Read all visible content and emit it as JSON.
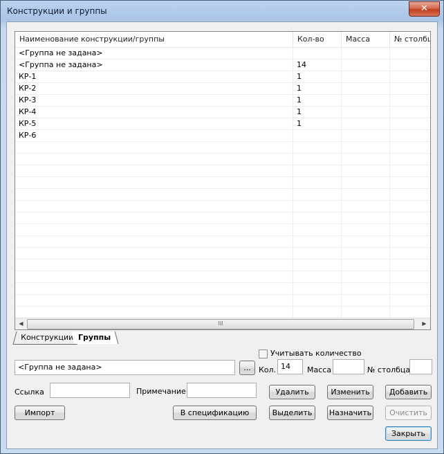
{
  "window": {
    "title": "Конструкции и группы",
    "close_label": "✕"
  },
  "grid": {
    "columns": [
      "Наименование конструкции/группы",
      "Кол-во",
      "Масса",
      "№ столбца"
    ],
    "rows": [
      [
        "<Группа не задана>",
        "",
        "",
        ""
      ],
      [
        "<Группа не задана>",
        "14",
        "",
        ""
      ],
      [
        "КР-1",
        "1",
        "",
        ""
      ],
      [
        "КР-2",
        "1",
        "",
        ""
      ],
      [
        "КР-3",
        "1",
        "",
        ""
      ],
      [
        "КР-4",
        "1",
        "",
        ""
      ],
      [
        "КР-5",
        "1",
        "",
        ""
      ],
      [
        "КР-6",
        "",
        "",
        ""
      ]
    ],
    "scroll_thumb_glyph": "III"
  },
  "tabs": [
    {
      "label": "Конструкции",
      "active": false
    },
    {
      "label": "Группы",
      "active": true
    }
  ],
  "form": {
    "consider_quantity_label": "Учитывать количество",
    "consider_quantity_checked": false,
    "group_value": "<Группа не задана>",
    "browse_label": "...",
    "qty_label": "Кол.",
    "qty_value": "14",
    "mass_label": "Масса",
    "mass_value": "",
    "column_label": "№ столбца",
    "column_value": "",
    "link_label": "Ссылка",
    "link_value": "",
    "note_label": "Примечание",
    "note_value": ""
  },
  "buttons": {
    "delete": "Удалить",
    "change": "Изменить",
    "add": "Добавить",
    "import": "Импорт",
    "to_spec": "В спецификацию",
    "select": "Выделить",
    "assign": "Назначить",
    "clear": "Очистить",
    "close": "Закрыть"
  }
}
